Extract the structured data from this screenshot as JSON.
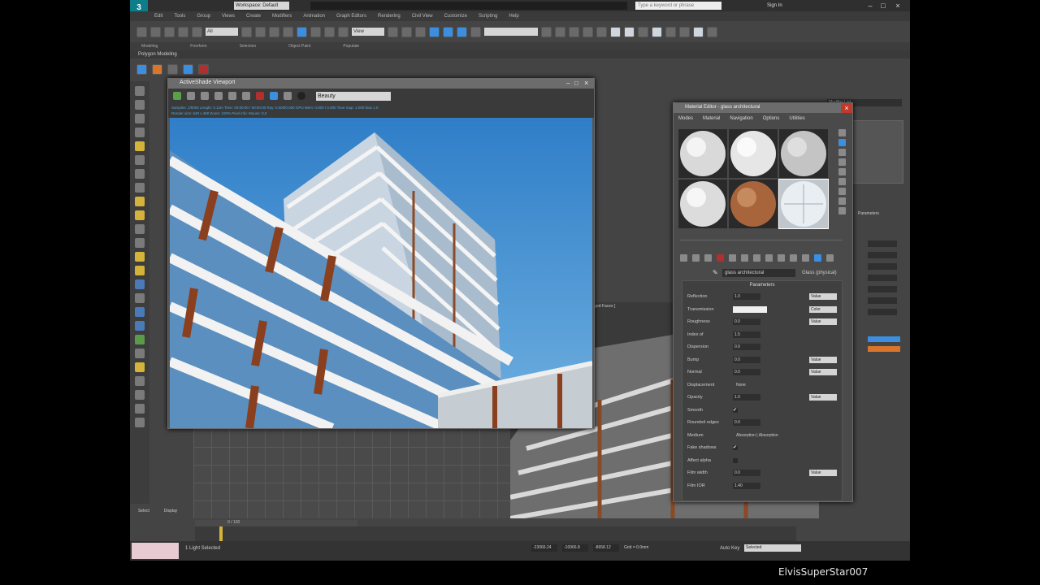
{
  "titlebar": {
    "workspace": "Workspace: Default",
    "search_placeholder": "Type a keyword or phrase",
    "sign_in": "Sign In"
  },
  "menu": [
    "Edit",
    "Tools",
    "Group",
    "Views",
    "Create",
    "Modifiers",
    "Animation",
    "Graph Editors",
    "Rendering",
    "Civil View",
    "Customize",
    "Scripting",
    "Help"
  ],
  "toolbar": {
    "selection_filter": "All",
    "view": "View"
  },
  "ribbon": {
    "tabs": [
      "Modeling",
      "Freeform",
      "Selection",
      "Object Paint",
      "Populate"
    ],
    "sub": "Polygon Modeling"
  },
  "render_frame": {
    "title": "ActiveShade Viewport",
    "preset": "Beauty",
    "stats_line1": "Samples: 1/5000   Length: 0.12m   Time: 00:00:00 / 00:00:00   Ray: 0.000/0.000   GPU Mem: 0.000 / 0.000   Tone map: 1.000 bias 1.0",
    "stats_line2": "Render size: 640 x 480   Zoom: 100%   Pixel info: Mouse: 0,0"
  },
  "material_editor": {
    "title": "Material Editor - glass architectural",
    "menu": [
      "Modes",
      "Material",
      "Navigation",
      "Options",
      "Utilities"
    ],
    "material_name": "glass architectural",
    "material_type": "Glass (physical)",
    "rollout": "Parameters",
    "params": [
      {
        "label": "Reflection",
        "value": "1.0",
        "dd": "Value"
      },
      {
        "label": "Transmission",
        "color": "#f0f0f0",
        "dd": "Color"
      },
      {
        "label": "Roughness",
        "value": "0.0",
        "dd": "Value"
      },
      {
        "label": "Index of",
        "value": "1.5"
      },
      {
        "label": "Dispersion",
        "value": "0.0"
      },
      {
        "label": "Bump",
        "value": "0.0",
        "dd": "Value"
      },
      {
        "label": "Normal",
        "value": "0.0",
        "dd": "Value"
      },
      {
        "label": "Displacement",
        "mid": "None"
      },
      {
        "label": "Opacity",
        "value": "1.0",
        "dd": "Value"
      },
      {
        "label": "Smooth",
        "check": "✔"
      },
      {
        "label": "Rounded edges",
        "value": "0.0"
      },
      {
        "label": "Medium",
        "mid": "Absorption  |  Absorption"
      },
      {
        "label": "Fake shadows",
        "check": "✔"
      },
      {
        "label": "Affect alpha",
        "check": ""
      },
      {
        "label": "Film width",
        "value": "0.0",
        "dd": "Value"
      },
      {
        "label": "Film IOR",
        "value": "1.40"
      }
    ]
  },
  "viewport_label": "[ + Edged Faces ]",
  "command_panel": {
    "modifier_list": "Modifier List",
    "rollout": "Parameters",
    "select": "Select",
    "display": "Display",
    "accent_blue": "#3b8ee0",
    "accent_orange": "#d8752a"
  },
  "status": {
    "text": "1 Light Selected",
    "x": "-23066.24",
    "y": "-10066.8",
    "z": "-8658.12",
    "grid": "Grid = 0.0mm",
    "autokey": "Auto Key",
    "selected": "Selected",
    "frame_label": "0 / 100"
  },
  "watermark": "ElvisSuperStar007"
}
